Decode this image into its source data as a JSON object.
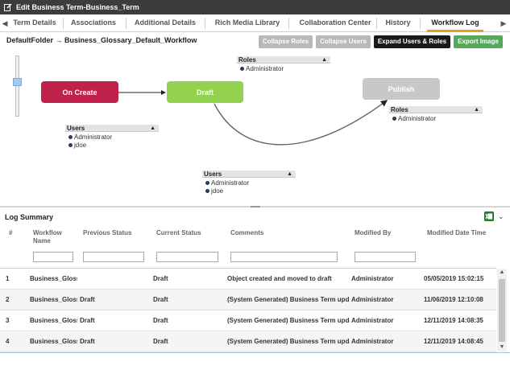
{
  "window": {
    "title": "Edit Business Term-Business_Term",
    "icon": "edit-window-icon"
  },
  "tabs": [
    {
      "label": "Term Details"
    },
    {
      "label": "Associations"
    },
    {
      "label": "Additional Details"
    },
    {
      "label": "Rich Media Library"
    },
    {
      "label": "Collaboration Center"
    },
    {
      "label": "History"
    },
    {
      "label": "Workflow Log",
      "active": true
    }
  ],
  "breadcrumb": "DefaultFolder → Business_Glossary_Default_Workflow",
  "toolbar": {
    "collapse_roles": "Collapse Roles",
    "collapse_users": "Collapse Users",
    "expand_users_roles": "Expand Users & Roles",
    "export_image": "Export Image"
  },
  "workflow": {
    "nodes": {
      "on_create": {
        "label": "On Create",
        "color": "#c0214b"
      },
      "draft": {
        "label": "Draft",
        "color": "#93d151"
      },
      "publish": {
        "label": "Publish",
        "color": "#c8c8c8"
      }
    },
    "draft_roles": {
      "header": "Roles",
      "items": [
        "Administrator"
      ]
    },
    "publish_roles": {
      "header": "Roles",
      "items": [
        "Administrator"
      ]
    },
    "create_users": {
      "header": "Users",
      "items": [
        "Administrator",
        "jdoe"
      ]
    },
    "draft_users": {
      "header": "Users",
      "items": [
        "Administrator",
        "jdoe"
      ]
    }
  },
  "log": {
    "title": "Log Summary",
    "columns": [
      "#",
      "Workflow Name",
      "Previous Status",
      "Current Status",
      "Comments",
      "Modified By",
      "Modified Date Time"
    ],
    "rows": [
      {
        "num": "1",
        "name": "Business_Glossary",
        "prev": "",
        "curr": "Draft",
        "comment": "Object created and moved to draft",
        "by": "Administrator",
        "date": "05/05/2019 15:02:15"
      },
      {
        "num": "2",
        "name": "Business_Glossary",
        "prev": "Draft",
        "curr": "Draft",
        "comment": "(System Generated) Business Term updated",
        "by": "Administrator",
        "date": "11/06/2019 12:10:08"
      },
      {
        "num": "3",
        "name": "Business_Glossary",
        "prev": "Draft",
        "curr": "Draft",
        "comment": "(System Generated) Business Term updated",
        "by": "Administrator",
        "date": "12/11/2019 14:08:35"
      },
      {
        "num": "4",
        "name": "Business_Glossary",
        "prev": "Draft",
        "curr": "Draft",
        "comment": "(System Generated) Business Term updated",
        "by": "Administrator",
        "date": "12/11/2019 14:08:45"
      }
    ]
  },
  "colors": {
    "accent_tab": "#e3a21a",
    "titlebar": "#3c3c3c",
    "export_button": "#56a85a"
  }
}
